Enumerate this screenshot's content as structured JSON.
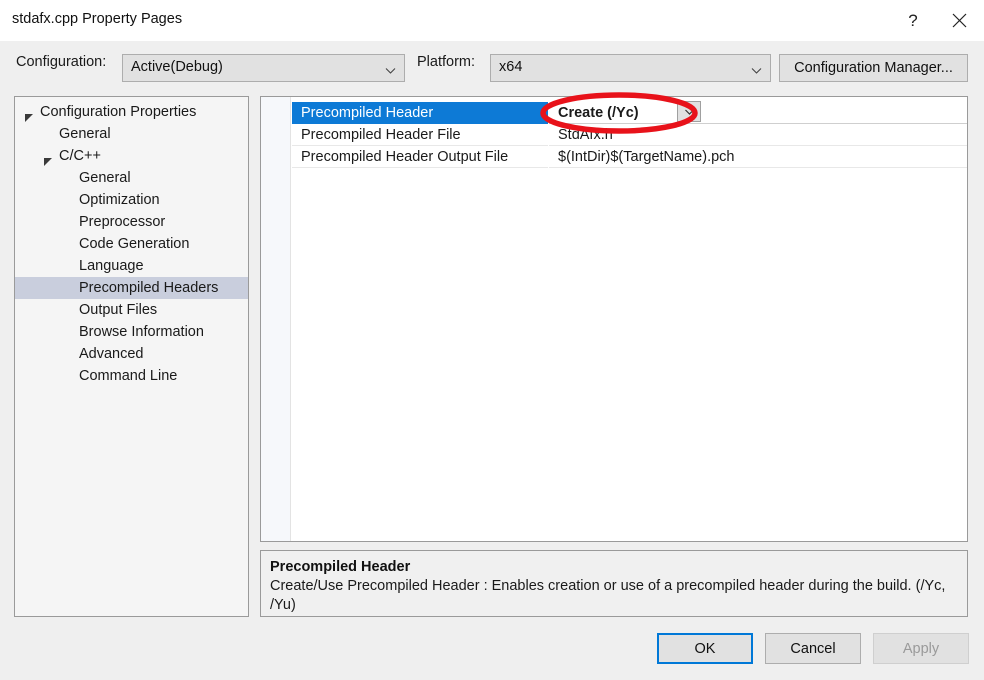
{
  "window": {
    "title": "stdafx.cpp Property Pages",
    "help_icon": "question-mark-icon",
    "close_icon": "close-icon"
  },
  "config_bar": {
    "configuration_label": "Configuration:",
    "configuration_value": "Active(Debug)",
    "platform_label": "Platform:",
    "platform_value": "x64",
    "configuration_manager_label": "Configuration Manager..."
  },
  "tree": {
    "items": [
      {
        "label": "Configuration Properties",
        "level": 0,
        "expanded": true,
        "selected": false
      },
      {
        "label": "General",
        "level": 1,
        "expanded": null,
        "selected": false
      },
      {
        "label": "C/C++",
        "level": 1,
        "expanded": true,
        "selected": false
      },
      {
        "label": "General",
        "level": 2,
        "expanded": null,
        "selected": false
      },
      {
        "label": "Optimization",
        "level": 2,
        "expanded": null,
        "selected": false
      },
      {
        "label": "Preprocessor",
        "level": 2,
        "expanded": null,
        "selected": false
      },
      {
        "label": "Code Generation",
        "level": 2,
        "expanded": null,
        "selected": false
      },
      {
        "label": "Language",
        "level": 2,
        "expanded": null,
        "selected": false
      },
      {
        "label": "Precompiled Headers",
        "level": 2,
        "expanded": null,
        "selected": true
      },
      {
        "label": "Output Files",
        "level": 2,
        "expanded": null,
        "selected": false
      },
      {
        "label": "Browse Information",
        "level": 2,
        "expanded": null,
        "selected": false
      },
      {
        "label": "Advanced",
        "level": 2,
        "expanded": null,
        "selected": false
      },
      {
        "label": "Command Line",
        "level": 2,
        "expanded": null,
        "selected": false
      }
    ]
  },
  "grid": {
    "rows": [
      {
        "name": "Precompiled Header",
        "value": "Create (/Yc)",
        "selected": true
      },
      {
        "name": "Precompiled Header File",
        "value": "StdAfx.h",
        "selected": false
      },
      {
        "name": "Precompiled Header Output File",
        "value": "$(IntDir)$(TargetName).pch",
        "selected": false
      }
    ],
    "dropdown_icon": "chevron-down-icon"
  },
  "description": {
    "title": "Precompiled Header",
    "body": "Create/Use Precompiled Header : Enables creation or use of a precompiled header during the build. (/Yc, /Yu)"
  },
  "footer": {
    "ok_label": "OK",
    "cancel_label": "Cancel",
    "apply_label": "Apply"
  },
  "annotation": {
    "shape": "red-ellipse-highlight",
    "color": "#e8121a",
    "target": "Create (/Yc)"
  },
  "colors": {
    "selection_blue": "#0d7ad6",
    "tree_selection": "#c9cedd",
    "focus_blue": "#0078d7",
    "dialog_background": "#efefef",
    "annotation_red": "#e8121a"
  }
}
